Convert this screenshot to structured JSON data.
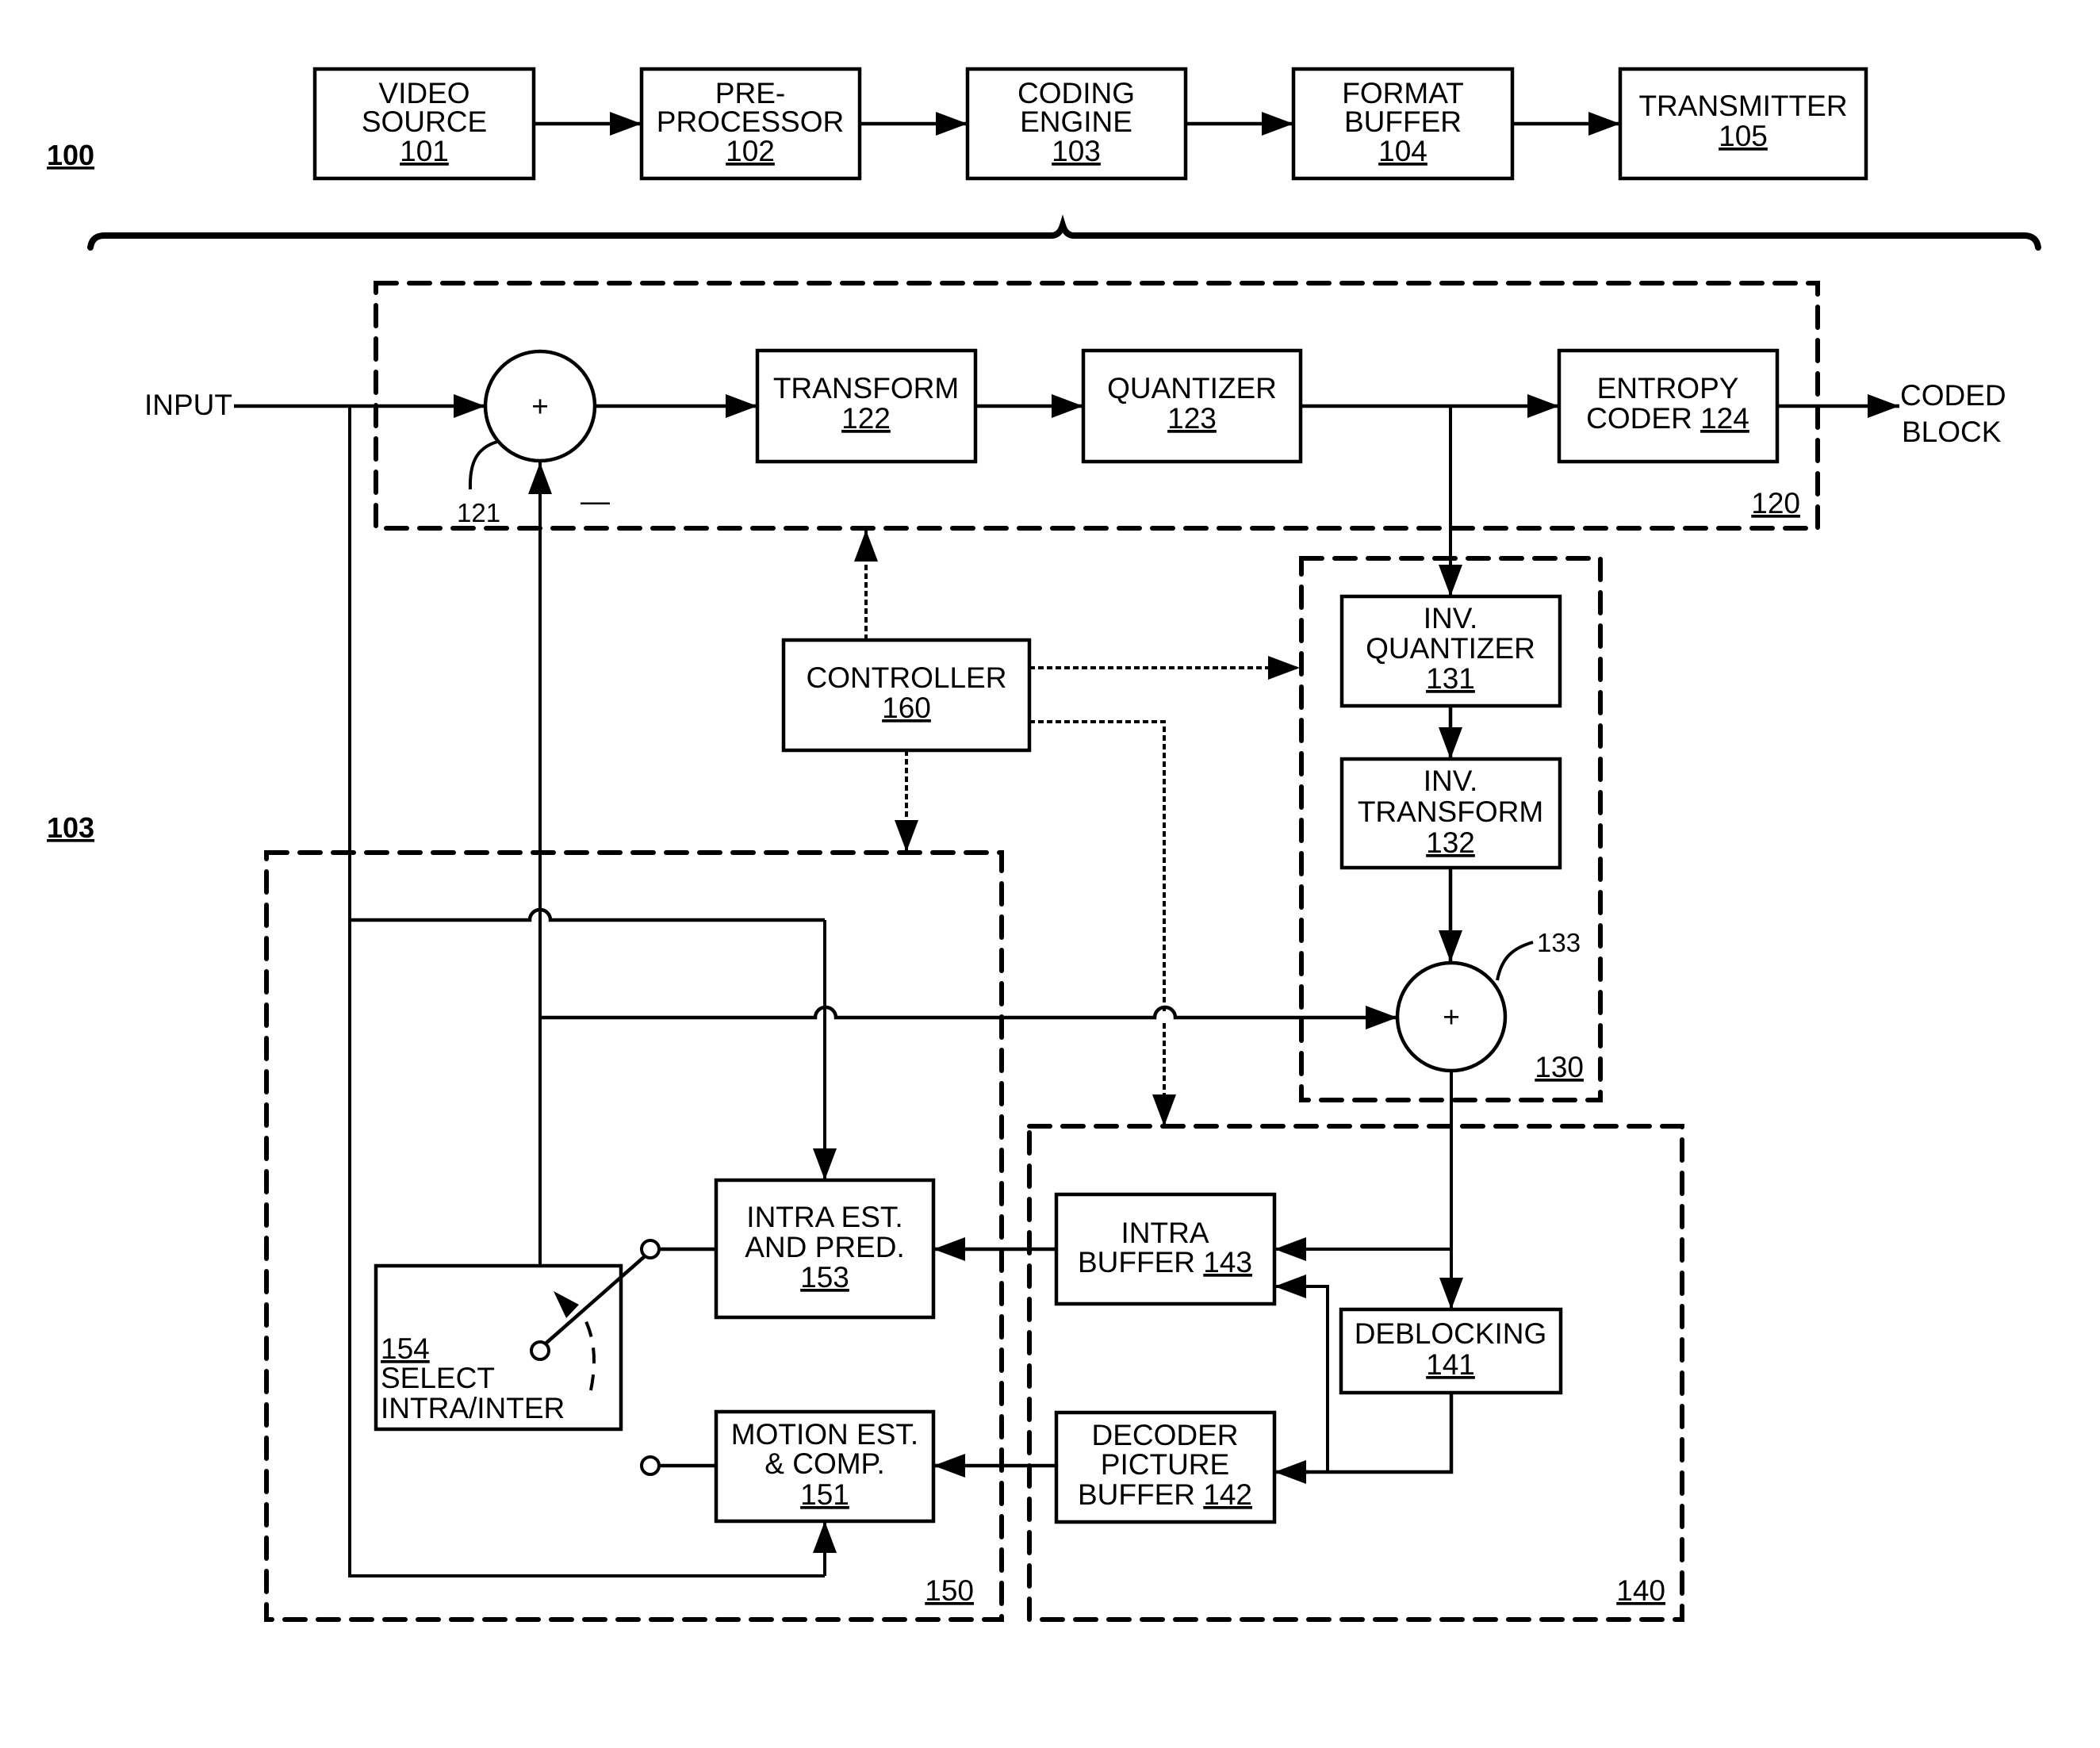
{
  "figure": {
    "system_label": "100",
    "engine_label": "103"
  },
  "pipeline": [
    {
      "lines": [
        "VIDEO",
        "SOURCE"
      ],
      "ref": "101"
    },
    {
      "lines": [
        "PRE-",
        "PROCESSOR"
      ],
      "ref": "102"
    },
    {
      "lines": [
        "CODING",
        "ENGINE"
      ],
      "ref": "103"
    },
    {
      "lines": [
        "FORMAT",
        "BUFFER"
      ],
      "ref": "104"
    },
    {
      "lines": [
        "TRANSMITTER"
      ],
      "ref": "105"
    }
  ],
  "forward_path": {
    "group_ref": "120",
    "input_label": "INPUT",
    "output_label": [
      "CODED",
      "BLOCK"
    ],
    "subtractor": {
      "symbol": "+",
      "ref": "121",
      "minus_sign": "—"
    },
    "transform": {
      "lines": [
        "TRANSFORM"
      ],
      "ref": "122"
    },
    "quantizer": {
      "lines": [
        "QUANTIZER"
      ],
      "ref": "123"
    },
    "entropy_coder": {
      "lines": [
        "ENTROPY",
        "CODER"
      ],
      "ref": "124"
    }
  },
  "reconstruction": {
    "group_ref": "130",
    "inv_quantizer": {
      "lines": [
        "INV.",
        "QUANTIZER"
      ],
      "ref": "131"
    },
    "inv_transform": {
      "lines": [
        "INV.",
        "TRANSFORM"
      ],
      "ref": "132"
    },
    "adder": {
      "symbol": "+",
      "ref": "133"
    }
  },
  "controller": {
    "lines": [
      "CONTROLLER"
    ],
    "ref": "160"
  },
  "buffers": {
    "group_ref": "140",
    "deblocking": {
      "lines": [
        "DEBLOCKING"
      ],
      "ref": "141"
    },
    "decoder_picture_buffer": {
      "lines": [
        "DECODER",
        "PICTURE",
        "BUFFER"
      ],
      "ref": "142"
    },
    "intra_buffer": {
      "lines": [
        "INTRA",
        "BUFFER"
      ],
      "ref": "143"
    }
  },
  "prediction": {
    "group_ref": "150",
    "motion": {
      "lines": [
        "MOTION EST.",
        "& COMP."
      ],
      "ref": "151"
    },
    "intra": {
      "lines": [
        "INTRA EST.",
        "AND PRED."
      ],
      "ref": "153"
    },
    "selector": {
      "ref": "154",
      "lines": [
        "SELECT",
        "INTRA/INTER"
      ]
    }
  }
}
